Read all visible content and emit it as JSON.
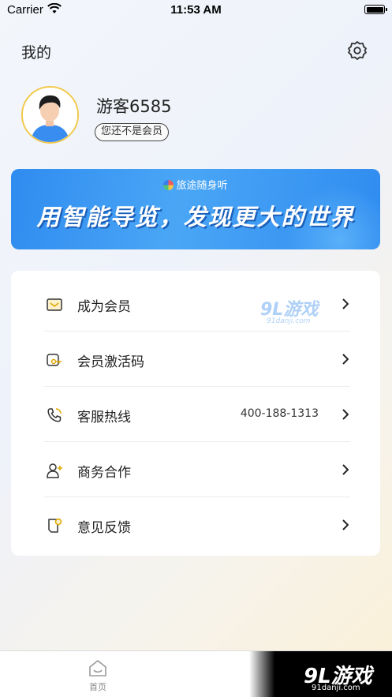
{
  "status_bar": {
    "carrier": "Carrier",
    "time": "11:53 AM"
  },
  "header": {
    "title": "我的",
    "settings_icon": "gear-icon"
  },
  "profile": {
    "username": "游客6585",
    "member_status": "您还不是会员"
  },
  "banner": {
    "brand": "旅途随身听",
    "slogan": "用智能导览，发现更大的世界"
  },
  "menu": [
    {
      "label": "成为会员",
      "icon": "member-card-icon",
      "value": ""
    },
    {
      "label": "会员激活码",
      "icon": "activation-key-icon",
      "value": ""
    },
    {
      "label": "客服热线",
      "icon": "phone-icon",
      "value": "400-188-1313"
    },
    {
      "label": "商务合作",
      "icon": "add-user-icon",
      "value": ""
    },
    {
      "label": "意见反馈",
      "icon": "feedback-icon",
      "value": ""
    }
  ],
  "watermark": {
    "main": "9L游戏",
    "sub": "91danji.com"
  },
  "tabbar": {
    "home_label": "首页"
  },
  "corner_logo": {
    "main": "9L游戏",
    "sub": "91danji.com"
  },
  "colors": {
    "accent_gold": "#f2c94c",
    "banner_blue": "#2f8cf0"
  }
}
